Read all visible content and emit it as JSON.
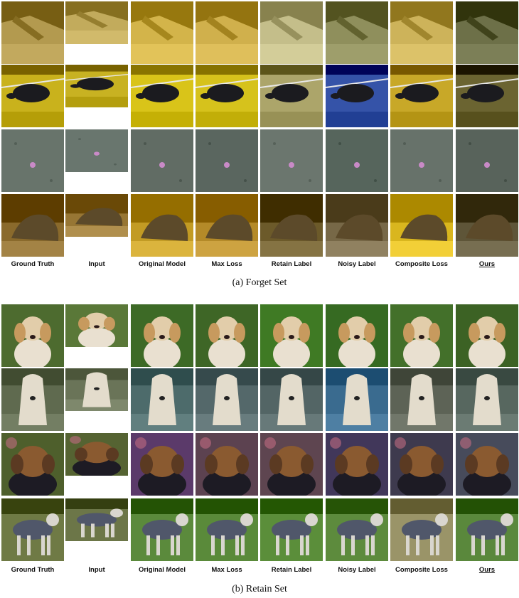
{
  "columns": [
    "Ground Truth",
    "Input",
    "Original Model",
    "Max Loss",
    "Retain Label",
    "Noisy Label",
    "Composite Loss",
    "Ours"
  ],
  "highlighted_column": "Ours",
  "sections": [
    {
      "caption": "(a) Forget Set",
      "rows": [
        {
          "subject": "dim-room-yellow-floor",
          "tints": [
            "#b39a4f",
            "#c2ab5c",
            "#d3b44a",
            "#d0b04c",
            "#c4be8a",
            "#8f8f5c",
            "#cdb35a",
            "#6d7048"
          ]
        },
        {
          "subject": "black-animal-yellow-floor",
          "tints": [
            "#c9b21c",
            "#c8b222",
            "#d9c419",
            "#d6c21c",
            "#aca56a",
            "#3553a8",
            "#c8a828",
            "#6b6431"
          ]
        },
        {
          "subject": "gray-pond-small-object",
          "tints": [
            "#6c786f",
            "#6d7a72",
            "#657068",
            "#5e6a63",
            "#6f7a72",
            "#5a6960",
            "#6b766e",
            "#5c675f"
          ]
        },
        {
          "subject": "hedgehog-on-yellow",
          "tints": [
            "#8a6a2c",
            "#977634",
            "#c29b24",
            "#b48a28",
            "#6c5a2a",
            "#776847",
            "#d9b61e",
            "#5e5538"
          ]
        }
      ]
    },
    {
      "caption": "(b) Retain Set",
      "rows": [
        {
          "subject": "golden-dog-grass",
          "tints": [
            "#4d6b2f",
            "#5a7838",
            "#3d6a26",
            "#3e6626",
            "#3f7a24",
            "#366a22",
            "#43702a",
            "#3c6224"
          ]
        },
        {
          "subject": "long-hair-dog-gravel",
          "tints": [
            "#5f6a4f",
            "#6a7458",
            "#4d6b6b",
            "#54686a",
            "#536565",
            "#3a6b8f",
            "#5d6356",
            "#57675f"
          ]
        },
        {
          "subject": "brown-dog-garden",
          "tints": [
            "#4e5f2c",
            "#556332",
            "#5b3a6a",
            "#5c4250",
            "#5e4550",
            "#41375a",
            "#3e3a4e",
            "#474b5b"
          ]
        },
        {
          "subject": "gray-dog-standing-grass",
          "tints": [
            "#6f7a45",
            "#6c7648",
            "#5b8a3c",
            "#5a8a3a",
            "#5b8e3a",
            "#5d8b3d",
            "#9a9468",
            "#5a883c"
          ]
        }
      ]
    }
  ]
}
